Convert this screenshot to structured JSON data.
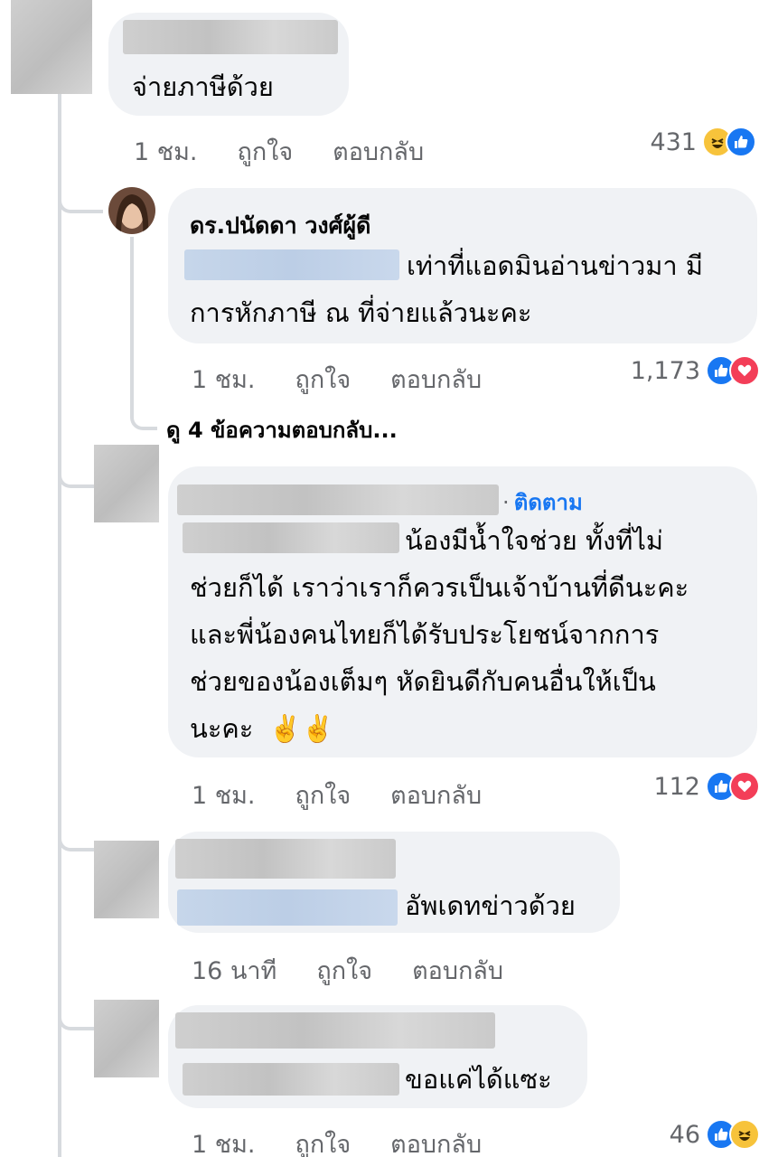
{
  "comments": [
    {
      "text": "จ่ายภาษีด้วย",
      "time": "1 ชม.",
      "like": "ถูกใจ",
      "reply": "ตอบกลับ",
      "reaction_count": "431",
      "reactions": [
        "haha-icon",
        "like-icon"
      ]
    },
    {
      "author": "ดร.ปนัดดา วงศ์ผู้ดี",
      "text_line1": "เท่าที่แอดมินอ่านข่าวมา มี",
      "text_line2": "การหักภาษี ณ ที่จ่ายแล้วนะคะ",
      "time": "1 ชม.",
      "like": "ถูกใจ",
      "reply": "ตอบกลับ",
      "reaction_count": "1,173",
      "reactions": [
        "like-icon",
        "love-icon"
      ]
    },
    {
      "follow_sep": "·",
      "follow": "ติดตาม",
      "text_line1": "น้องมีน้ำใจช่วย ทั้งที่ไม่",
      "text_line2": "ช่วยก็ได้ เราว่าเราก็ควรเป็นเจ้าบ้านที่ดีนะคะ",
      "text_line3": "และพี่น้องคนไทยก็ได้รับประโยชน์จากการ",
      "text_line4": "ช่วยของน้องเต็มๆ หัดยินดีกับคนอื่นให้เป็น",
      "text_line5": "นะคะ",
      "emoji": "✌️✌️",
      "time": "1 ชม.",
      "like": "ถูกใจ",
      "reply": "ตอบกลับ",
      "reaction_count": "112",
      "reactions": [
        "like-icon",
        "love-icon"
      ]
    },
    {
      "text": "อัพเดทข่าวด้วย",
      "time": "16 นาที",
      "like": "ถูกใจ",
      "reply": "ตอบกลับ"
    },
    {
      "text": "ขอแค่ได้แซะ",
      "time": "1 ชม.",
      "like": "ถูกใจ",
      "reply": "ตอบกลับ",
      "reaction_count": "46",
      "reactions": [
        "like-icon",
        "haha-icon"
      ]
    }
  ],
  "view_replies": "ดู 4 ข้อความตอบกลับ...",
  "colors": {
    "like": "#1877f2",
    "love": "#f33e58",
    "haha": "#f7c33b",
    "bubble": "#f0f2f5",
    "meta": "#65676b"
  }
}
